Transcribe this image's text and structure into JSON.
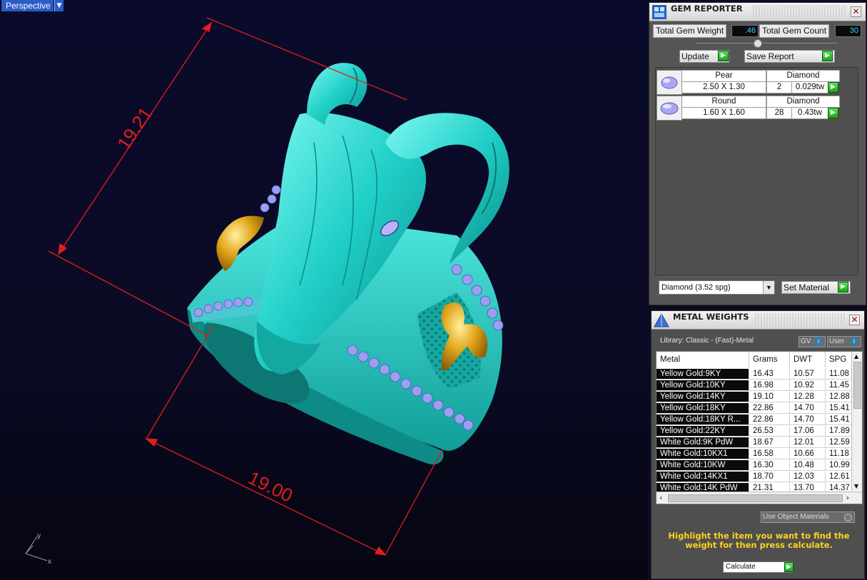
{
  "viewport": {
    "label": "Perspective",
    "dimensions": {
      "height": "19.21",
      "width": "19.00"
    },
    "axes": {
      "y": "y",
      "x": "x"
    }
  },
  "gem_reporter": {
    "title": "GEM REPORTER",
    "total_weight_label": "Total Gem Weight",
    "total_weight_value": ".46",
    "total_count_label": "Total Gem Count",
    "total_count_value": "30",
    "update_label": "Update",
    "save_label": "Save Report",
    "gems": [
      {
        "shape": "Pear",
        "type": "Diamond",
        "size": "2.50 X 1.30",
        "count": "2",
        "weight": "0.029tw"
      },
      {
        "shape": "Round",
        "type": "Diamond",
        "size": "1.60 X 1.60",
        "count": "28",
        "weight": "0.43tw"
      }
    ],
    "material_select": "Diamond    (3.52 spg)",
    "set_material_label": "Set Material"
  },
  "metal_weights": {
    "title": "METAL WEIGHTS",
    "library": "Library: Classic - (Fast)-Metal",
    "gv_label": "GV",
    "user_label": "User",
    "columns": [
      "Metal",
      "Grams",
      "DWT",
      "SPG"
    ],
    "rows": [
      [
        "Yellow Gold:9KY",
        "16.43",
        "10.57",
        "11.08"
      ],
      [
        "Yellow Gold:10KY",
        "16.98",
        "10.92",
        "11.45"
      ],
      [
        "Yellow Gold:14KY",
        "19.10",
        "12.28",
        "12.88"
      ],
      [
        "Yellow Gold:18KY",
        "22.86",
        "14.70",
        "15.41"
      ],
      [
        "Yellow Gold:18KY R...",
        "22.86",
        "14.70",
        "15.41"
      ],
      [
        "Yellow Gold:22KY",
        "26.53",
        "17.06",
        "17.89"
      ],
      [
        "White Gold:9K PdW",
        "18.67",
        "12.01",
        "12.59"
      ],
      [
        "White Gold:10KX1",
        "16.58",
        "10.66",
        "11.18"
      ],
      [
        "White Gold:10KW",
        "16.30",
        "10.48",
        "10.99"
      ],
      [
        "White Gold:14KX1",
        "18.70",
        "12.03",
        "12.61"
      ],
      [
        "White Gold:14K PdW",
        "21.31",
        "13.70",
        "14.37"
      ]
    ],
    "use_object_materials": "Use Object Materials",
    "instructions": "Highlight the item you want to find the weight for then press calculate.",
    "calculate_label": "Calculate"
  }
}
